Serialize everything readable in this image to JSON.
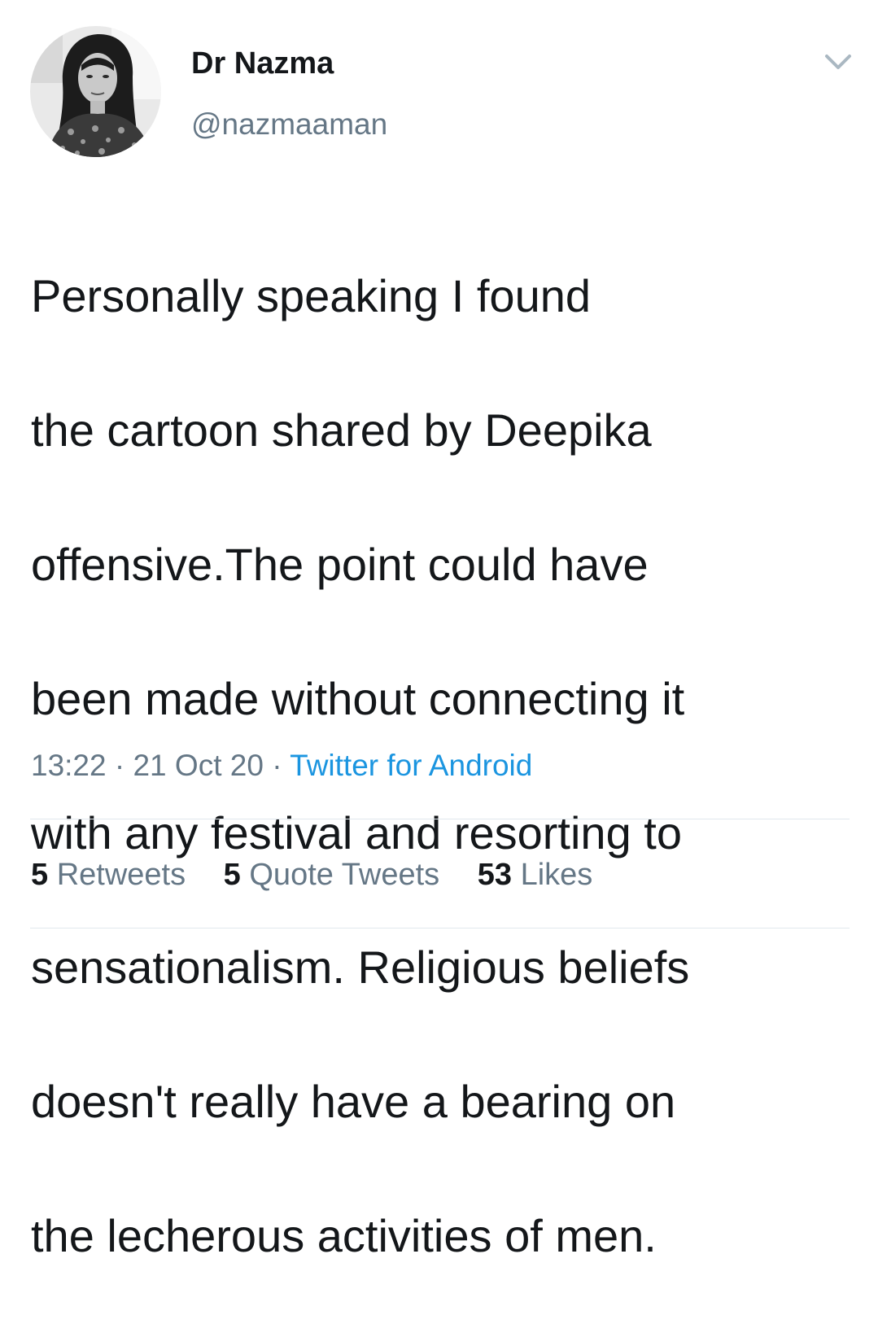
{
  "author": {
    "display_name": "Dr Nazma",
    "handle": "@nazmaaman",
    "avatar_icon": "profile-photo"
  },
  "tweet": {
    "text_lines": [
      "Personally speaking I found",
      "the cartoon shared by Deepika",
      "offensive.The point could have",
      "been made without connecting it",
      "with any festival and resorting to",
      "sensationalism. Religious beliefs",
      "doesn't really have a bearing on",
      "the lecherous activities of men."
    ],
    "time": "13:22",
    "date": "21 Oct 20",
    "separator": "·",
    "source": "Twitter for Android"
  },
  "stats": {
    "retweets_count": "5",
    "retweets_label": "Retweets",
    "quotes_count": "5",
    "quotes_label": "Quote Tweets",
    "likes_count": "53",
    "likes_label": "Likes"
  },
  "colors": {
    "text": "#14171a",
    "secondary": "#657786",
    "link": "#1b95e0",
    "divider": "#e1e8ed"
  },
  "icons": {
    "more": "chevron-down-icon"
  }
}
